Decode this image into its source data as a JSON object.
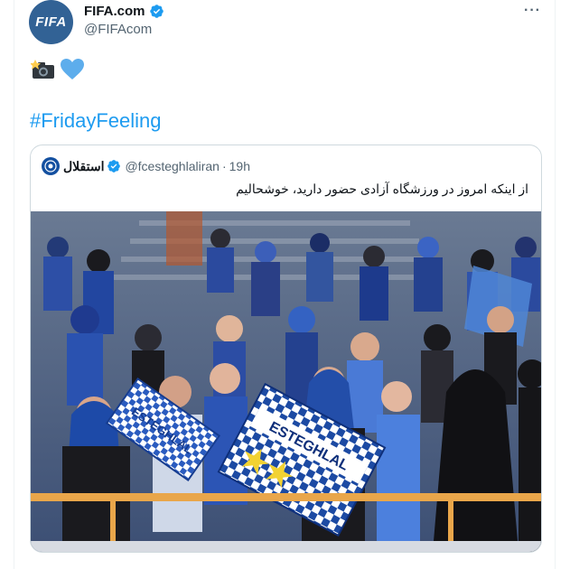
{
  "tweet": {
    "display_name": "FIFA.com",
    "handle": "@FIFAcom",
    "avatar_text": "FIFA",
    "emojis": [
      "camera-flash-emoji",
      "blue-heart-emoji"
    ],
    "hashtag": "#FridayFeeling",
    "more_icon": "ellipsis-icon"
  },
  "quote": {
    "display_name": "استقلال",
    "handle": "@fcesteghlaliran",
    "separator": "·",
    "time": "19h",
    "text": "از اینکه امروز در ورزشگاه آزادی حضور دارید، خوشحالیم",
    "photo": {
      "flag_text": "ESTEGHLAL",
      "banner_text": "ESTEGHLAL"
    }
  },
  "colors": {
    "accent": "#1d9bf0",
    "verified": "#1d9bf0",
    "secondary_text": "#536471",
    "fifa_blue": "#326295",
    "esteghlal_blue": "#1450a0"
  }
}
